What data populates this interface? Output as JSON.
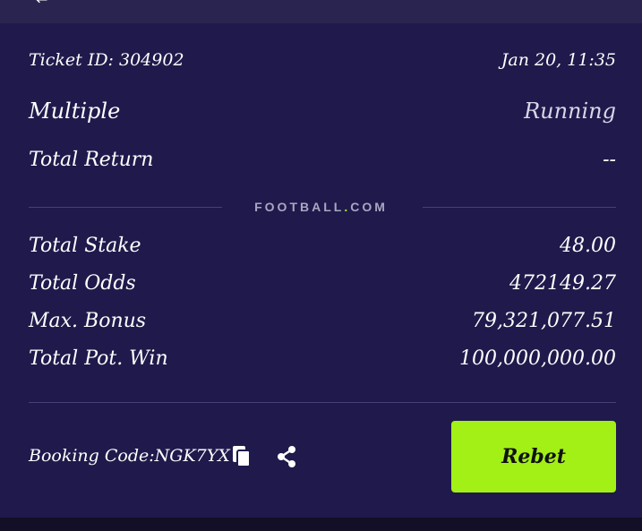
{
  "ticket": {
    "id_label": "Ticket ID: 304902",
    "datetime": "Jan 20, 11:35",
    "bet_type": "Multiple",
    "status": "Running",
    "total_return_label": "Total Return",
    "total_return_value": "--"
  },
  "brand": {
    "text_before_dot": "FOOTBALL",
    "dot": ".",
    "text_after_dot": "COM",
    "accent_color": "#a3f016"
  },
  "summary": {
    "total_stake_label": "Total Stake",
    "total_stake_value": "48.00",
    "total_odds_label": "Total Odds",
    "total_odds_value": "472149.27",
    "max_bonus_label": "Max. Bonus",
    "max_bonus_value": "79,321,077.51",
    "total_pot_win_label": "Total Pot. Win",
    "total_pot_win_value": "100,000,000.00"
  },
  "footer": {
    "booking_code": "Booking Code:NGK7YX",
    "copy_icon": "copy-icon",
    "share_icon": "share-icon",
    "rebet_label": "Rebet"
  }
}
